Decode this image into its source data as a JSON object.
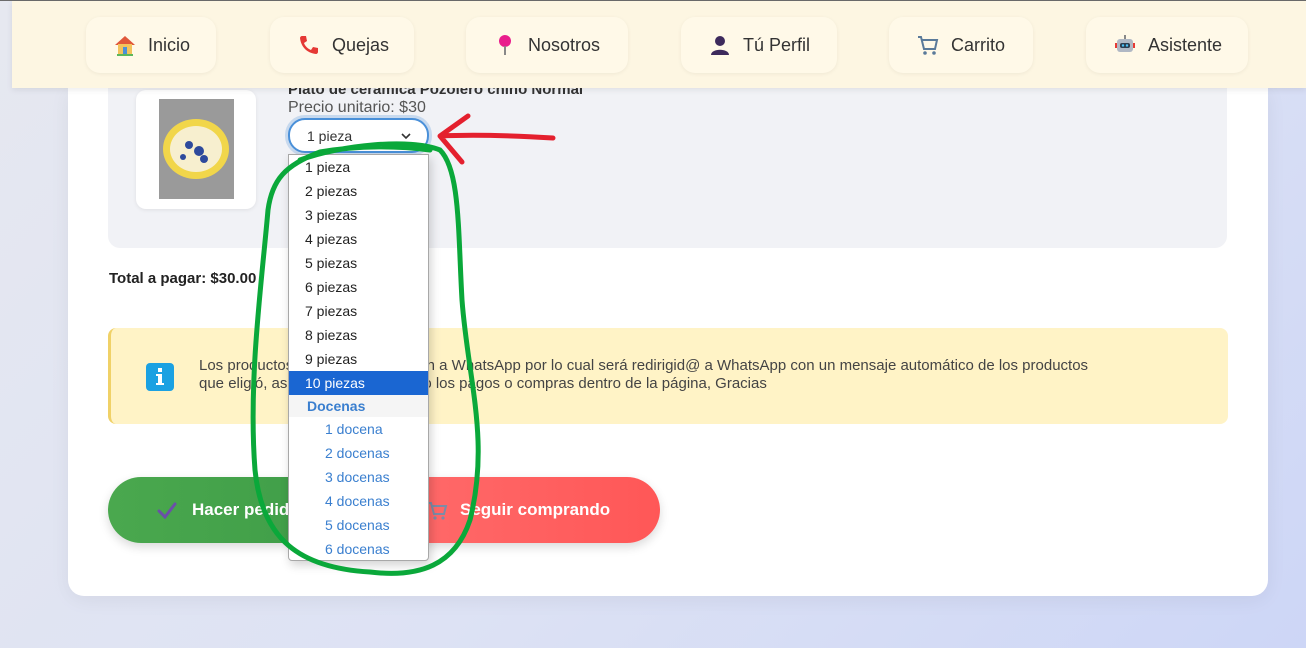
{
  "nav": {
    "items": [
      {
        "label": "Inicio",
        "icon": "house-icon"
      },
      {
        "label": "Quejas",
        "icon": "phone-icon"
      },
      {
        "label": "Nosotros",
        "icon": "pin-icon"
      },
      {
        "label": "Tú Perfil",
        "icon": "user-icon"
      },
      {
        "label": "Carrito",
        "icon": "cart-icon"
      },
      {
        "label": "Asistente",
        "icon": "robot-icon"
      }
    ]
  },
  "cart": {
    "product_name": "Plato de cerámica Pozolero chino Normal",
    "unit_price": "Precio unitario: $30",
    "quantity_selected": "1 pieza",
    "total": "Total a pagar: $30.00"
  },
  "dropdown": {
    "pieces": [
      "1 pieza",
      "2 piezas",
      "3 piezas",
      "4 piezas",
      "5 piezas",
      "6 piezas",
      "7 piezas",
      "8 piezas",
      "9 piezas",
      "10 piezas"
    ],
    "highlighted": "10 piezas",
    "group_label": "Docenas",
    "dozens": [
      "1 docena",
      "2 docenas",
      "3 docenas",
      "4 docenas",
      "5 docenas",
      "6 docenas"
    ]
  },
  "notice": {
    "line1": "Los productos que elija se enviarán a WhatsApp por lo cual será redirigid@ a WhatsApp con un mensaje automático de los productos",
    "line2": "que eligió, así no estarán haciendo los pagos o compras dentro de la página, Gracias"
  },
  "buttons": {
    "order": "Hacer pedido",
    "continue": "Seguir comprando"
  },
  "colors": {
    "order_button": "#4aa84e",
    "continue_button": "#ff5f5f",
    "annotation_arrow": "#e4202e",
    "annotation_circle": "#0aa83a",
    "selected_option": "#1a66d2"
  }
}
